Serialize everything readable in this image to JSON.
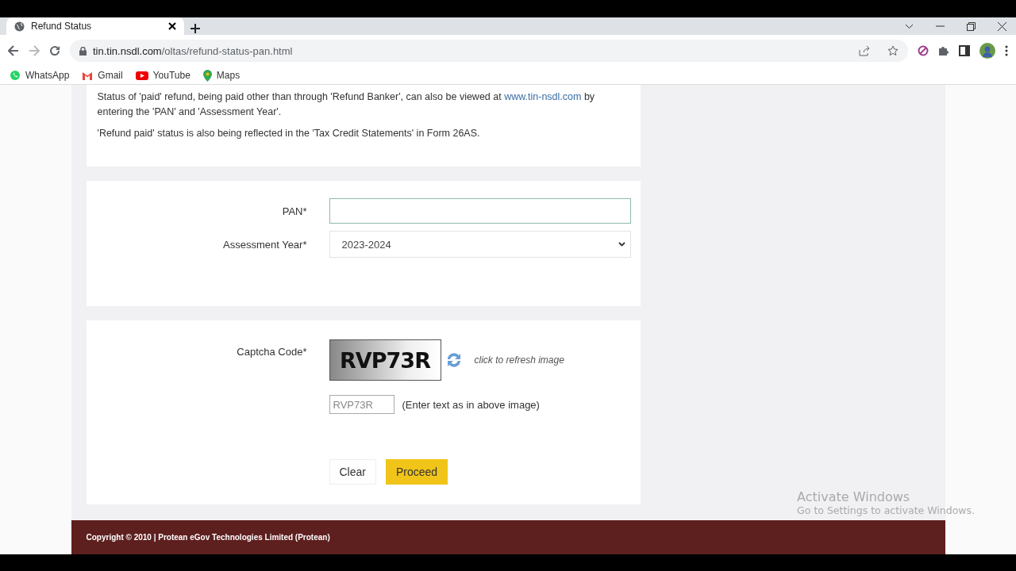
{
  "browser": {
    "tab_title": "Refund Status",
    "url_host": "tin.tin.nsdl.com",
    "url_path": "/oltas/refund-status-pan.html",
    "bookmarks": [
      {
        "label": "WhatsApp",
        "kind": "whatsapp"
      },
      {
        "label": "Gmail",
        "kind": "gmail"
      },
      {
        "label": "YouTube",
        "kind": "youtube"
      },
      {
        "label": "Maps",
        "kind": "maps"
      }
    ]
  },
  "info": {
    "paragraph_1_start": "Status of 'paid' refund, being paid other than through 'Refund Banker', can also be viewed at ",
    "link": "www.tin-nsdl.com",
    "paragraph_1_end": " by entering the 'PAN' and 'Assessment Year'.",
    "paragraph_2": "'Refund paid' status is also being reflected in the 'Tax Credit Statements' in Form 26AS."
  },
  "form": {
    "pan_label": "PAN*",
    "assessment_year_label": "Assessment Year*",
    "assessment_year_value": "2023-2024"
  },
  "captcha": {
    "label": "Captcha Code*",
    "image_text": "RVP73R",
    "refresh_text": "click to refresh image",
    "input_value": "RVP73R",
    "hint": "(Enter text as in above image)"
  },
  "buttons": [
    "Clear",
    "Proceed"
  ],
  "footer": "Copyright © 2010 | Protean eGov Technologies Limited (Protean)",
  "os_notice": {
    "title": "Activate Windows",
    "subtitle": "Go to Settings to activate Windows."
  }
}
